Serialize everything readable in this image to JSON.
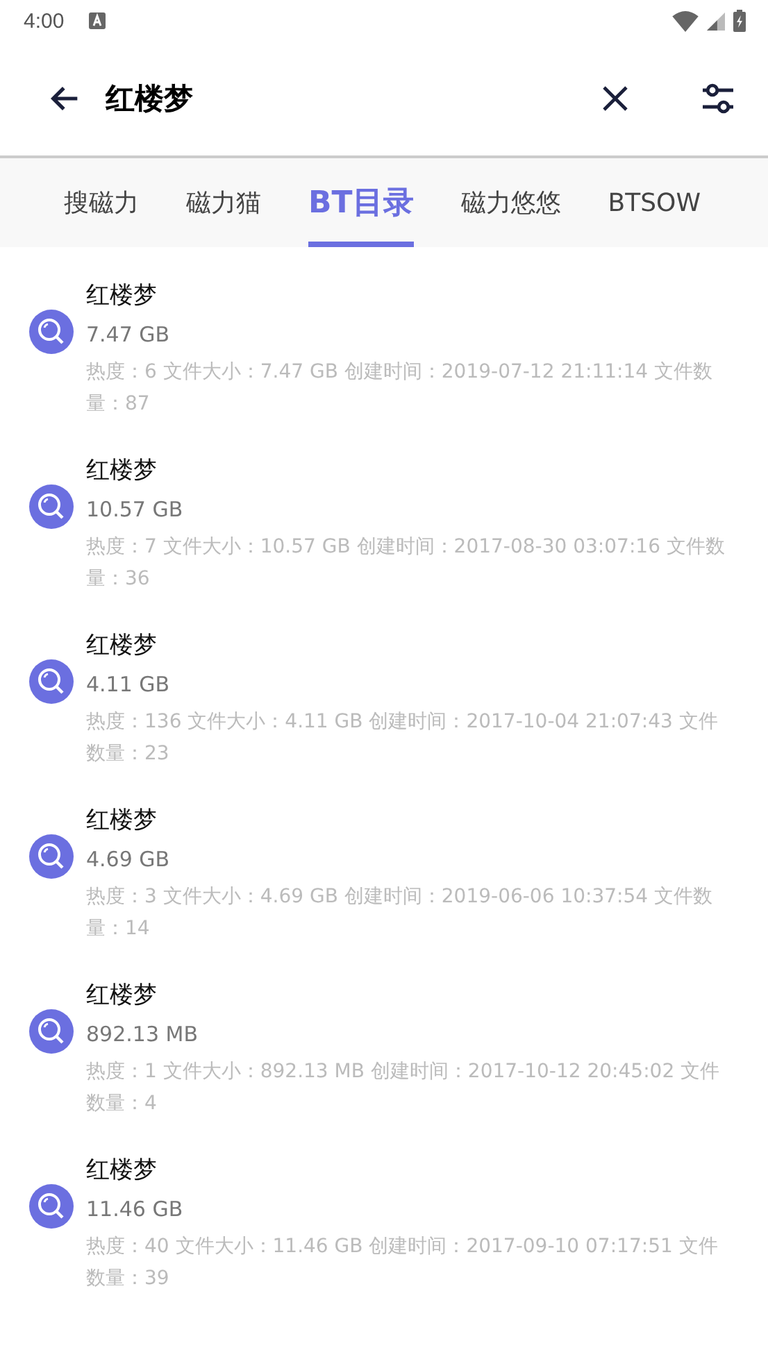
{
  "status_bar": {
    "time": "4:00"
  },
  "search": {
    "value": "红楼梦"
  },
  "tabs": [
    {
      "label": "搜磁力",
      "selected": false
    },
    {
      "label": "磁力猫",
      "selected": false
    },
    {
      "label": "BT目录",
      "selected": true
    },
    {
      "label": "磁力悠悠",
      "selected": false
    },
    {
      "label": "BTSOW",
      "selected": false
    }
  ],
  "results": [
    {
      "title": "红楼梦",
      "size": "7.47 GB",
      "details": "热度：6  文件大小：7.47 GB  创建时间：2019-07-12 21:11:14  文件数量：87"
    },
    {
      "title": "红楼梦",
      "size": "10.57 GB",
      "details": "热度：7  文件大小：10.57 GB  创建时间：2017-08-30 03:07:16  文件数量：36"
    },
    {
      "title": "红楼梦",
      "size": "4.11 GB",
      "details": "热度：136  文件大小：4.11 GB  创建时间：2017-10-04 21:07:43  文件数量：23"
    },
    {
      "title": "红楼梦",
      "size": "4.69 GB",
      "details": "热度：3  文件大小：4.69 GB  创建时间：2019-06-06 10:37:54  文件数量：14"
    },
    {
      "title": "红楼梦",
      "size": "892.13 MB",
      "details": "热度：1  文件大小：892.13 MB  创建时间：2017-10-12 20:45:02  文件数量：4"
    },
    {
      "title": "红楼梦",
      "size": "11.46 GB",
      "details": "热度：40  文件大小：11.46 GB  创建时间：2017-09-10 07:17:51  文件数量：39"
    }
  ]
}
